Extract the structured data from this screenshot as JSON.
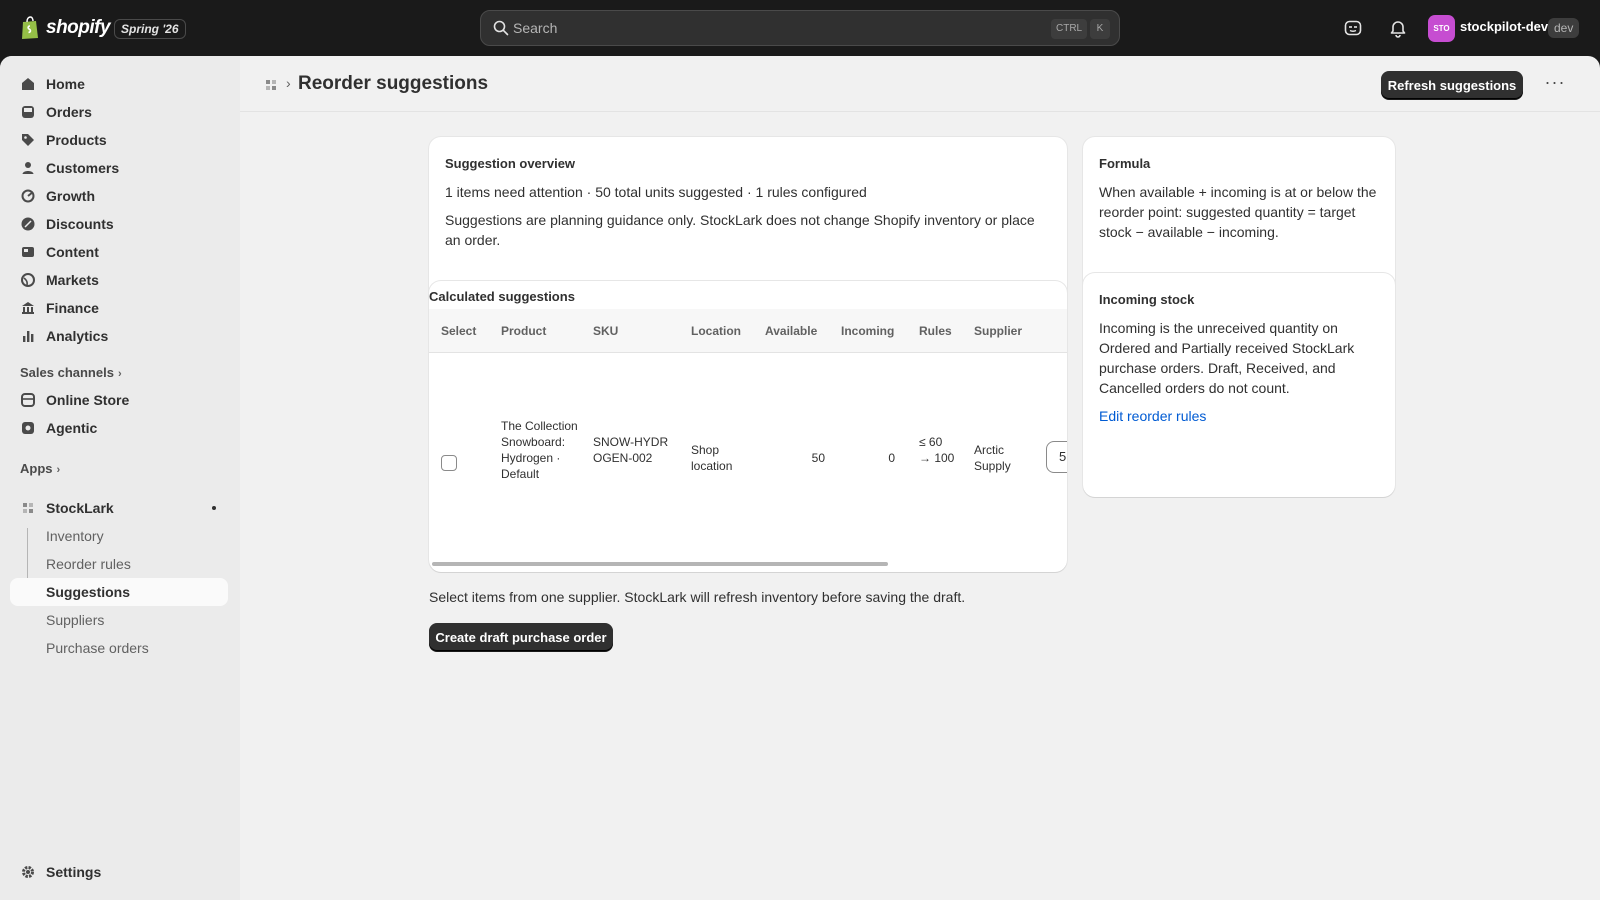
{
  "topbar": {
    "logo_text": "shopify",
    "edition": "Spring '26",
    "search_placeholder": "Search",
    "shortcut_ctrl": "CTRL",
    "shortcut_k": "K",
    "avatar_initials": "STO",
    "store_name": "stockpilot-dev",
    "store_tag": "dev"
  },
  "sidebar": {
    "items": [
      {
        "label": "Home",
        "icon": "home-icon"
      },
      {
        "label": "Orders",
        "icon": "orders-icon"
      },
      {
        "label": "Products",
        "icon": "tag-icon"
      },
      {
        "label": "Customers",
        "icon": "person-icon"
      },
      {
        "label": "Growth",
        "icon": "growth-icon"
      },
      {
        "label": "Discounts",
        "icon": "discount-icon"
      },
      {
        "label": "Content",
        "icon": "content-icon"
      },
      {
        "label": "Markets",
        "icon": "globe-icon"
      },
      {
        "label": "Finance",
        "icon": "bank-icon"
      },
      {
        "label": "Analytics",
        "icon": "bar-chart-icon"
      }
    ],
    "sales_channels_label": "Sales channels",
    "channels": [
      {
        "label": "Online Store",
        "icon": "store-icon"
      },
      {
        "label": "Agentic",
        "icon": "agent-icon"
      }
    ],
    "apps_label": "Apps",
    "app_name": "StockLark",
    "app_subitems": [
      "Inventory",
      "Reorder rules",
      "Suggestions",
      "Suppliers",
      "Purchase orders"
    ],
    "active_subitem": "Suggestions",
    "settings_label": "Settings"
  },
  "header": {
    "title": "Reorder suggestions",
    "refresh_button": "Refresh suggestions",
    "more_label": "···"
  },
  "overview": {
    "title": "Suggestion overview",
    "summary": "1 items need attention · 50 total units suggested · 1 rules configured",
    "note": "Suggestions are planning guidance only. StockLark does not change Shopify inventory or place an order."
  },
  "table": {
    "title": "Calculated suggestions",
    "columns": [
      "Select",
      "Product",
      "SKU",
      "Location",
      "Available",
      "Incoming",
      "Rules",
      "Supplier"
    ],
    "rows": [
      {
        "product": "The Collection Snowboard: Hydrogen · Default",
        "sku": "SNOW-HYDROGEN-002",
        "location": "Shop location",
        "available": "50",
        "incoming": "0",
        "rules": "≤ 60 → 100",
        "supplier": "Arctic Supply",
        "quantity": "5"
      }
    ]
  },
  "formula": {
    "title": "Formula",
    "text": "When available + incoming is at or below the reorder point: suggested quantity = target stock − available − incoming."
  },
  "incoming": {
    "title": "Incoming stock",
    "text": "Incoming is the unreceived quantity on Ordered and Partially received StockLark purchase orders. Draft, Received, and Cancelled orders do not count.",
    "link": "Edit reorder rules"
  },
  "footer": {
    "helper": "Select items from one supplier. StockLark will refresh inventory before saving the draft.",
    "create_button": "Create draft purchase order"
  }
}
